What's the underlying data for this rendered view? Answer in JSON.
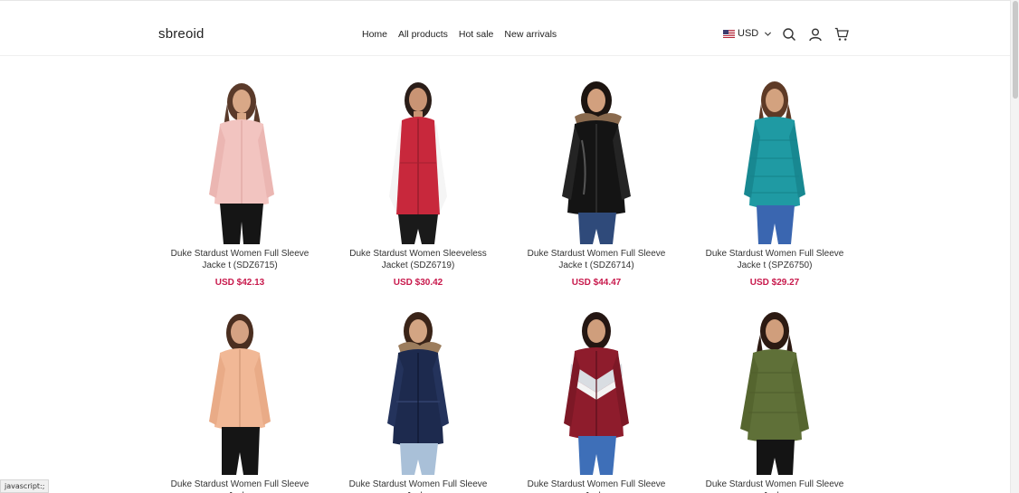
{
  "header": {
    "logo": "sbreoid",
    "nav": [
      "Home",
      "All products",
      "Hot sale",
      "New arrivals"
    ],
    "currency": "USD"
  },
  "products": [
    {
      "name": "Duke Stardust Women Full Sleeve Jacke t (SDZ6715)",
      "price": "USD $42.13",
      "color": "#f2c4c0",
      "style": "jacket"
    },
    {
      "name": "Duke Stardust Women Sleeveless Jacket (SDZ6719)",
      "price": "USD $30.42",
      "color": "#c8283c",
      "style": "vest"
    },
    {
      "name": "Duke Stardust Women Full Sleeve Jacke t (SDZ6714)",
      "price": "USD $44.47",
      "color": "#141414",
      "style": "hood"
    },
    {
      "name": "Duke Stardust Women Full Sleeve Jacke t (SPZ6750)",
      "price": "USD $29.27",
      "color": "#1f9aa3",
      "style": "jacket"
    },
    {
      "name": "Duke Stardust Women Full Sleeve Jacke",
      "price": "",
      "color": "#f1b896",
      "style": "jacket"
    },
    {
      "name": "Duke Stardust Women Full Sleeve Jacke",
      "price": "",
      "color": "#1d2a4e",
      "style": "hood"
    },
    {
      "name": "Duke Stardust Women Full Sleeve Jacke",
      "price": "",
      "color": "#8e1c2c",
      "style": "bomber"
    },
    {
      "name": "Duke Stardust Women Full Sleeve Jacke",
      "price": "",
      "color": "#5f7038",
      "style": "jacket"
    }
  ],
  "status_bar": "javascript:;"
}
